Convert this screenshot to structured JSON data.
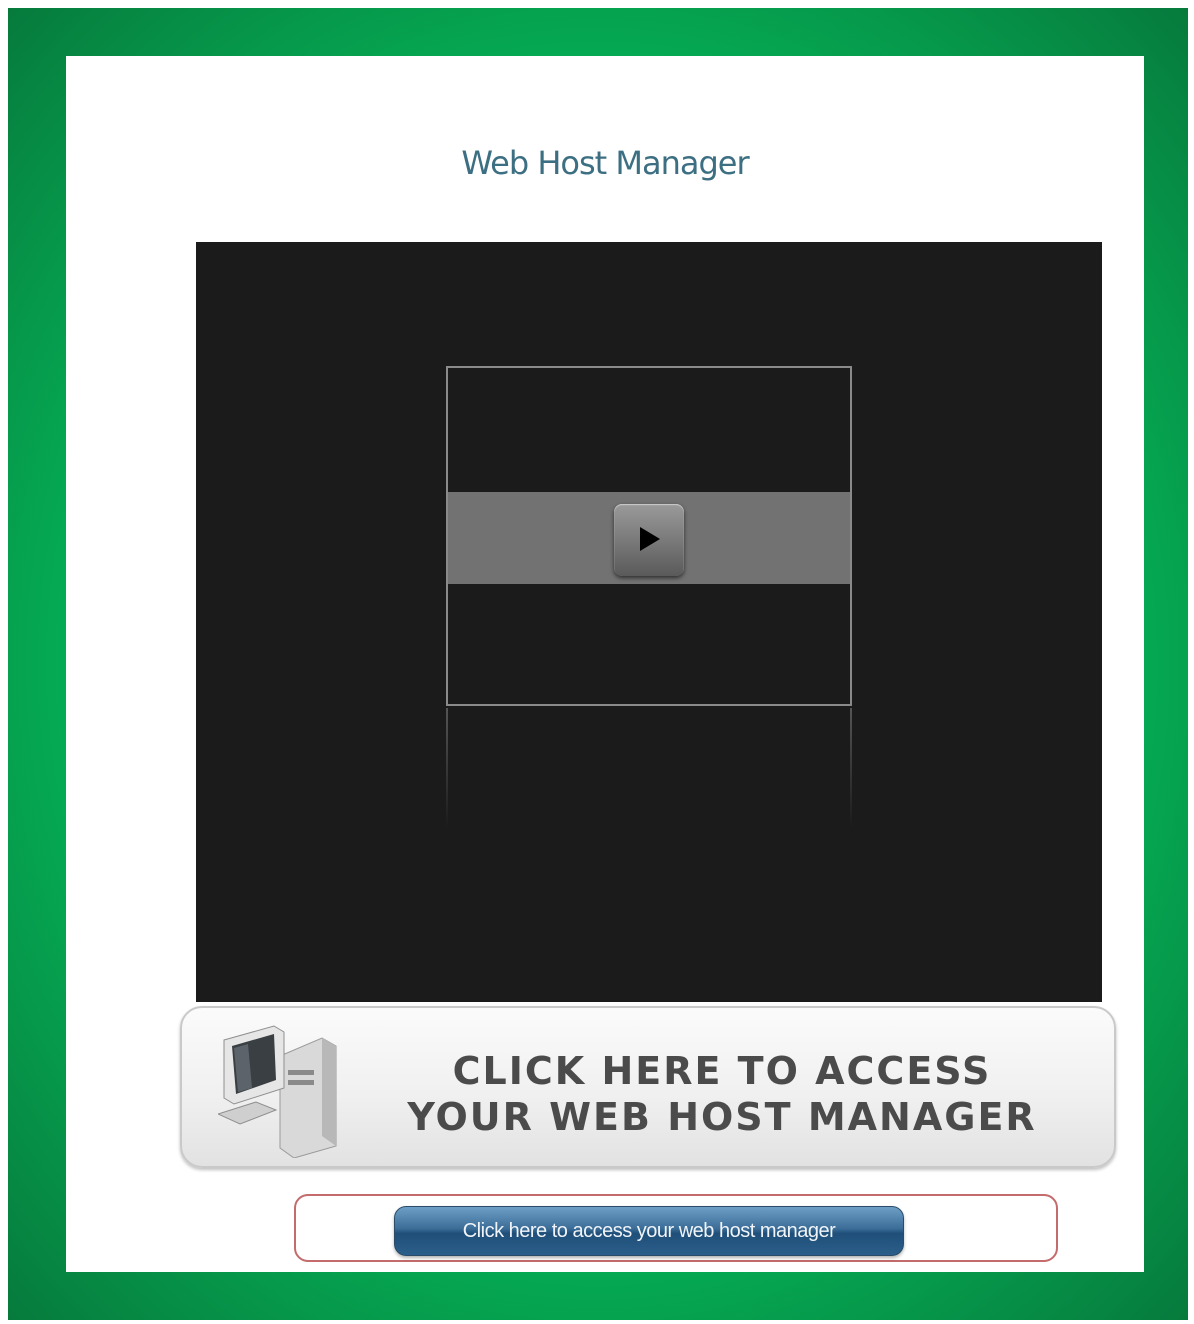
{
  "page": {
    "title": "Web Host Manager"
  },
  "video": {
    "play_icon": "play-icon"
  },
  "banner": {
    "line1": "CLICK HERE TO ACCESS",
    "line2": "YOUR WEB HOST MANAGER",
    "icon": "computer-icon"
  },
  "access_button": {
    "label": "Click here to access your web host manager"
  },
  "colors": {
    "frame": "#05b75a",
    "video_bg": "#1b1b1b",
    "title": "#3d6f83",
    "button": "#3b6d98"
  }
}
